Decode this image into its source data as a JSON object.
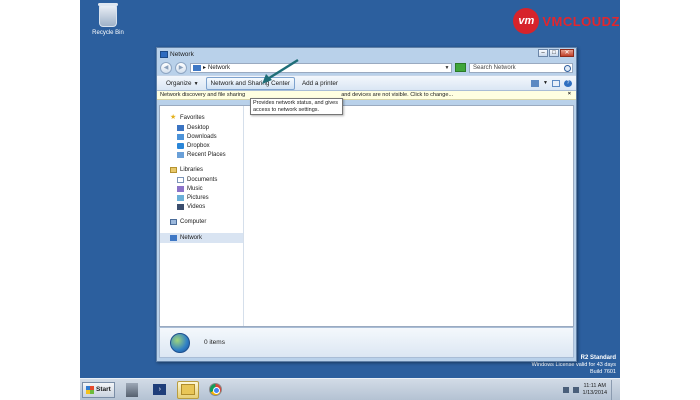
{
  "desktop": {
    "recycle_bin_label": "Recycle Bin",
    "brand_logo_text": "vm",
    "brand_wordmark": "VMCLOUDZ",
    "windows_info": {
      "edition_line": "R2 Standard",
      "license_line": "Windows License valid for 43 days",
      "build_line": "Build 7601"
    }
  },
  "window": {
    "title": "Network",
    "address": {
      "location": "Network",
      "search_placeholder": "Search Network"
    },
    "command_bar": {
      "organize_label": "Organize",
      "network_sharing_label": "Network and Sharing Center",
      "add_printer_label": "Add a printer"
    },
    "infobar": {
      "text_left": "Network discovery and file sharing",
      "text_right": "and devices are not visible. Click to change...",
      "close_glyph": "×"
    },
    "tooltip": "Provides network status, and gives access to network settings.",
    "nav": {
      "favorites_label": "Favorites",
      "favorites": [
        "Desktop",
        "Downloads",
        "Dropbox",
        "Recent Places"
      ],
      "libraries_label": "Libraries",
      "libraries": [
        "Documents",
        "Music",
        "Pictures",
        "Videos"
      ],
      "computer_label": "Computer",
      "network_label": "Network"
    },
    "details": {
      "item_count": "0 items"
    }
  },
  "taskbar": {
    "start_label": "Start",
    "clock_time": "11:11 AM",
    "clock_date": "1/13/2014"
  },
  "colors": {
    "desktop_bg": "#2c5f9e",
    "brand_red": "#e3262d",
    "annotation_arrow": "#1f6e78"
  }
}
